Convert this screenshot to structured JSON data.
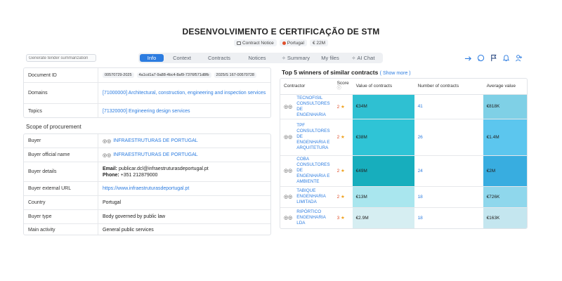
{
  "header": {
    "title": "DESENVOLVIMENTO E CERTIFICAÇÃO DE STM",
    "notice_type": "Contract Notice",
    "country": "Portugal",
    "value": "€ 22M"
  },
  "toolbar": {
    "generate_placeholder": "Generate tender summarization",
    "tabs": [
      {
        "label": "Info",
        "active": true
      },
      {
        "label": "Context"
      },
      {
        "label": "Contracts"
      },
      {
        "label": "Notices"
      },
      {
        "label": "Summary",
        "icon": "sparkle-icon"
      },
      {
        "label": "My files"
      },
      {
        "label": "AI Chat",
        "icon": "sparkle-icon"
      }
    ],
    "actions": [
      "share-icon",
      "comment-icon",
      "flag-icon",
      "bell-icon",
      "add-user-icon"
    ]
  },
  "identity": {
    "document_id_label": "Document ID",
    "document_ids": [
      "00570729-2025",
      "4a1cd1a7-9a88-4bc4-8af9-7376f571d8fb",
      "2025/S 167-00570728"
    ],
    "domains_label": "Domains",
    "domains_value": "[71000000] Architectural, construction, engineering and inspection services",
    "topics_label": "Topics",
    "topics_value": "[71320000] Engineering design services"
  },
  "scope": {
    "title": "Scope of procurement",
    "buyer_label": "Buyer",
    "buyer_value": "INFRAESTRUTURAS DE PORTUGAL",
    "official_label": "Buyer official name",
    "official_value": "INFRAESTRUTURAS DE PORTUGAL",
    "details_label": "Buyer details",
    "email_label": "Email:",
    "email_value": "publicar.dcl@infraestruturasdeportugal.pt",
    "phone_label": "Phone:",
    "phone_value": "+351 212879000",
    "url_label": "Buyer external URL",
    "url_value": "https://www.infraestruturasdeportugal.pt",
    "country_label": "Country",
    "country_value": "Portugal",
    "type_label": "Buyer type",
    "type_value": "Body governed by public law",
    "activity_label": "Main activity",
    "activity_value": "General public services"
  },
  "winners": {
    "title": "Top 5 winners of similar contracts",
    "show_more": "( Show more )",
    "columns": [
      "Contractor",
      "Score",
      "Value of contracts",
      "Number of contracts",
      "Average value"
    ],
    "rows": [
      {
        "name": "TECNOFISIL CONSULTORES DE ENGENHARIA",
        "score": "2",
        "value": "€34M",
        "count": "41",
        "avg": "€818K",
        "value_color": "#2fc0d2",
        "avg_color": "#7fd0e6"
      },
      {
        "name": "TPF CONSULTORES DE ENGENHARIA E ARQUITETURA",
        "score": "2",
        "value": "€38M",
        "count": "26",
        "avg": "€1.4M",
        "value_color": "#2fc4d6",
        "avg_color": "#5cc6ee"
      },
      {
        "name": "COBA CONSULTORES DE ENGENHARIA E AMBIENTE",
        "score": "2",
        "value": "€49M",
        "count": "24",
        "avg": "€2M",
        "value_color": "#17aebd",
        "avg_color": "#38ade0"
      },
      {
        "name": "TABIQUE ENGENHARIA LIMITADA",
        "score": "2",
        "value": "€13M",
        "count": "18",
        "avg": "€726K",
        "value_color": "#a9e6ee",
        "avg_color": "#8fd7ec"
      },
      {
        "name": "RIPÓRTICO ENGENHARIA LDA",
        "score": "3",
        "value": "€2.9M",
        "count": "18",
        "avg": "€163K",
        "value_color": "#d6eef2",
        "avg_color": "#c4e6ef"
      }
    ]
  }
}
